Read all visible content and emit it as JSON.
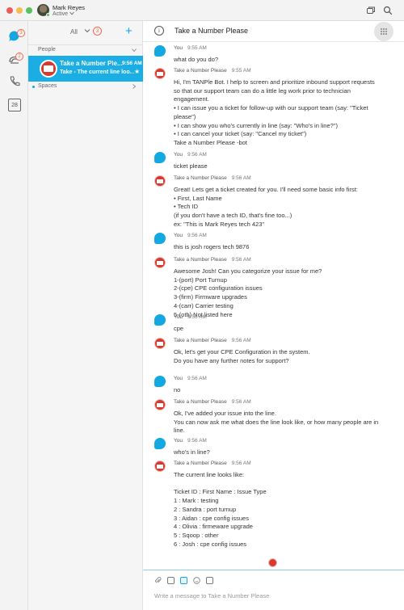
{
  "window": {
    "user_name": "Mark Reyes",
    "user_status": "Active"
  },
  "rail": {
    "chat_badge": "3",
    "calls_badge": "2",
    "calendar_day": "28"
  },
  "list": {
    "filter_label": "All",
    "filter_count": "3",
    "people_header": "People",
    "spaces_header": "Spaces",
    "conversation": {
      "name": "Take a Number Ple...",
      "time": "9:56 AM",
      "preview": "Take - The current line loo..."
    }
  },
  "main": {
    "title": "Take a Number Please",
    "composer_placeholder": "Write a message to Take a Number Please",
    "messages": [
      {
        "sender": "You",
        "time": "9:55 AM",
        "lines": [
          "what do you do?"
        ]
      },
      {
        "sender": "Take a Number Please",
        "time": "9:55 AM",
        "lines": [
          "Hi, I'm TANPle Bot. I help to screen and prioritize inbound support requests",
          "so that our support team can do a little leg work prior to technician",
          "engagement.",
          "• I can issue you a ticket for follow-up with our support team (say: \"Ticket",
          "please\")",
          "• I can show you who's currently in line (say: \"Who's in line?\")",
          "• I can cancel your ticket (say: \"Cancel my ticket\")",
          "Take a Number Please -bot"
        ]
      },
      {
        "sender": "You",
        "time": "9:56 AM",
        "lines": [
          "ticket please"
        ]
      },
      {
        "sender": "Take a Number Please",
        "time": "9:56 AM",
        "lines": [
          "Great! Lets get a ticket created for you. I'll need some basic info first:",
          "• First, Last Name",
          "• Tech ID",
          "(if you don't have a tech ID, that's fine too...)",
          "ex: \"This is Mark Reyes tech 423\""
        ]
      },
      {
        "sender": "You",
        "time": "9:56 AM",
        "lines": [
          "this is josh rogers tech 9876"
        ]
      },
      {
        "sender": "Take a Number Please",
        "time": "9:56 AM",
        "lines": [
          "Awesome Josh! Can you categorize your issue for me?",
          "1-(port) Port Turnup",
          "2-(cpe) CPE configuration issues",
          "3-(firm) Firmware upgrades",
          "4-(carr) Carrier testing",
          "5-(oth) Not listed here"
        ]
      },
      {
        "sender": "You",
        "time": "9:56 AM",
        "lines": [
          "cpe"
        ]
      },
      {
        "sender": "Take a Number Please",
        "time": "9:56 AM",
        "lines": [
          "Ok, let's get your CPE Configuration in the system.",
          "Do you have any further notes for support?"
        ]
      },
      {
        "sender": "You",
        "time": "9:56 AM",
        "lines": [
          "no"
        ]
      },
      {
        "sender": "Take a Number Please",
        "time": "9:56 AM",
        "lines": [
          "Ok, I've added your issue into the line.",
          "You can now ask me what does the line look like, or how many people are in",
          "line."
        ]
      },
      {
        "sender": "You",
        "time": "9:56 AM",
        "lines": [
          "who's in line?"
        ]
      },
      {
        "sender": "Take a Number Please",
        "time": "9:56 AM",
        "lines": [
          "The current line looks like:",
          "",
          "Ticket ID : First Name : Issue Type",
          "1 : Mark : testing",
          "2 : Sandra : port turnup",
          "3 : Aidan : cpe config issues",
          "4 : Olivia : firmeware upgrade",
          "5 : Sqoop : other",
          "6 : Josh : cpe config issues"
        ]
      }
    ]
  }
}
